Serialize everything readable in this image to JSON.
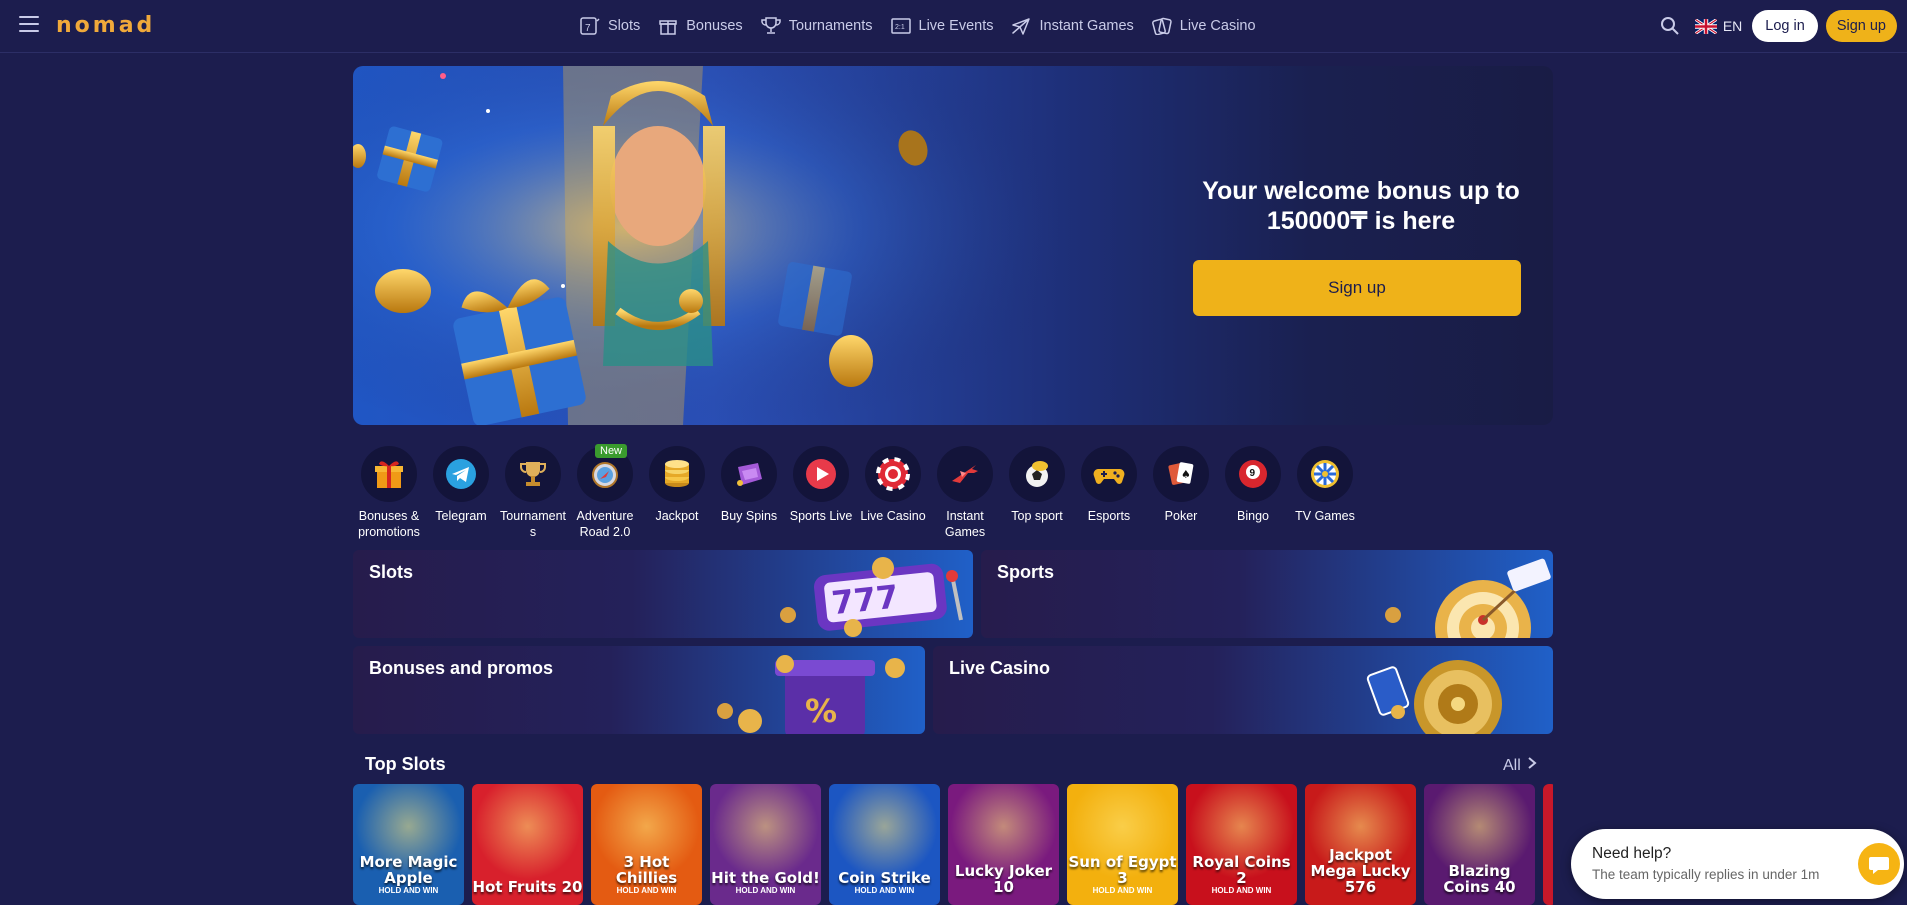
{
  "header": {
    "logo": "nomad",
    "nav": [
      {
        "label": "Slots",
        "icon": "slot-reel-icon"
      },
      {
        "label": "Bonuses",
        "icon": "gift-icon"
      },
      {
        "label": "Tournaments",
        "icon": "trophy-icon"
      },
      {
        "label": "Live Events",
        "icon": "scoreboard-icon"
      },
      {
        "label": "Instant Games",
        "icon": "plane-icon"
      },
      {
        "label": "Live Casino",
        "icon": "cards-icon"
      }
    ],
    "language": "EN",
    "login_label": "Log in",
    "signup_label": "Sign up"
  },
  "hero": {
    "title": "Your welcome bonus up to 150000₸ is here",
    "button_label": "Sign up"
  },
  "categories": [
    {
      "label": "Bonuses & promotions",
      "icon": "gift-icon"
    },
    {
      "label": "Telegram",
      "icon": "telegram-icon"
    },
    {
      "label": "Tournament s",
      "icon": "trophy-icon"
    },
    {
      "label": "Adventure Road 2.0",
      "icon": "compass-icon",
      "badge": "New"
    },
    {
      "label": "Jackpot",
      "icon": "coins-stack-icon"
    },
    {
      "label": "Buy Spins",
      "icon": "ticket-icon"
    },
    {
      "label": "Sports Live",
      "icon": "play-icon"
    },
    {
      "label": "Live Casino",
      "icon": "casino-chip-icon"
    },
    {
      "label": "Instant Games",
      "icon": "plane-icon"
    },
    {
      "label": "Top sport",
      "icon": "soccer-ball-icon"
    },
    {
      "label": "Esports",
      "icon": "gamepad-icon"
    },
    {
      "label": "Poker",
      "icon": "playing-cards-icon"
    },
    {
      "label": "Bingo",
      "icon": "bingo-ball-icon"
    },
    {
      "label": "TV Games",
      "icon": "wheel-icon"
    }
  ],
  "tiles": {
    "slots": "Slots",
    "sports": "Sports",
    "bonuses": "Bonuses and promos",
    "live_casino": "Live Casino"
  },
  "top_slots": {
    "title": "Top Slots",
    "all_label": "All",
    "games": [
      {
        "name": "More Magic Apple",
        "sub": "HOLD AND WIN",
        "color": "#1a5fb0"
      },
      {
        "name": "Hot Fruits 20",
        "sub": "",
        "color": "#d8202c"
      },
      {
        "name": "3 Hot Chillies",
        "sub": "HOLD AND WIN",
        "color": "#e45b12"
      },
      {
        "name": "Hit the Gold!",
        "sub": "HOLD AND WIN",
        "color": "#6a2a8c"
      },
      {
        "name": "Coin Strike",
        "sub": "HOLD AND WIN",
        "color": "#1c56c2"
      },
      {
        "name": "Lucky Joker 10",
        "sub": "",
        "color": "#7a1a7e"
      },
      {
        "name": "Sun of Egypt 3",
        "sub": "HOLD AND WIN",
        "color": "#f3b00e"
      },
      {
        "name": "Royal Coins 2",
        "sub": "HOLD AND WIN",
        "color": "#c8101c"
      },
      {
        "name": "Jackpot Mega Lucky 576",
        "sub": "",
        "color": "#c81a1a"
      },
      {
        "name": "Blazing Coins 40",
        "sub": "",
        "color": "#5a1a70"
      }
    ]
  },
  "help": {
    "title": "Need help?",
    "subtitle": "The team typically replies in under 1m"
  }
}
